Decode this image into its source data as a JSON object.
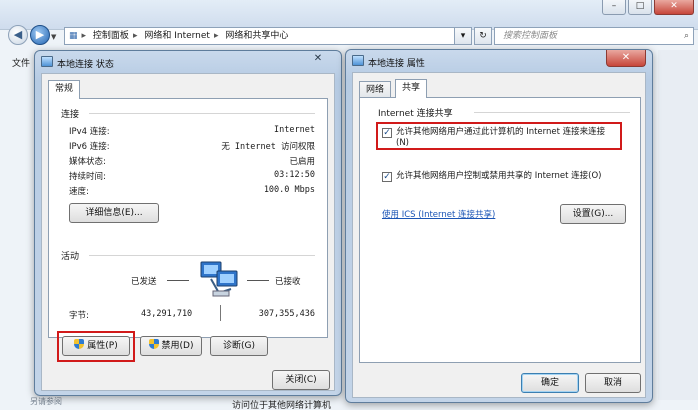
{
  "explorer": {
    "address": {
      "crumbs": [
        "控制面板",
        "网络和 Internet",
        "网络和共享中心"
      ],
      "refresh_glyph": "↻",
      "dropdown_glyph": "▾"
    },
    "search_placeholder": "搜索控制面板",
    "menu_fragment": "文件",
    "bottom_fragment": "访问位于其他网络计算机",
    "bottom_left_fragment": "另请参阅"
  },
  "status_dialog": {
    "title": "本地连接 状态",
    "close_glyph": "✕",
    "tab": "常规",
    "connection_label": "连接",
    "rows": [
      {
        "label": "IPv4 连接:",
        "value": "Internet"
      },
      {
        "label": "IPv6 连接:",
        "value": "无 Internet 访问权限"
      },
      {
        "label": "媒体状态:",
        "value": "已启用"
      },
      {
        "label": "持续时间:",
        "value": "03:12:50"
      },
      {
        "label": "速度:",
        "value": "100.0 Mbps"
      }
    ],
    "details_button": "详细信息(E)...",
    "activity_label": "活动",
    "sent_label": "已发送",
    "received_label": "已接收",
    "bytes_label": "字节:",
    "bytes_sent": "43,291,710",
    "bytes_received": "307,355,436",
    "properties_button": "属性(P)",
    "disable_button": "禁用(D)",
    "diagnose_button": "诊断(G)",
    "close_button": "关闭(C)"
  },
  "props_dialog": {
    "title": "本地连接 属性",
    "close_glyph": "✕",
    "tabs": [
      "网络",
      "共享"
    ],
    "group_title": "Internet 连接共享",
    "checkbox1": "允许其他网络用户通过此计算机的 Internet 连接来连接(N)",
    "checkbox2": "允许其他网络用户控制或禁用共享的 Internet 连接(O)",
    "check_glyph": "✓",
    "ics_link": "使用 ICS (Internet 连接共享)",
    "settings_button": "设置(G)...",
    "ok_button": "确定",
    "cancel_button": "取消"
  },
  "colors": {
    "highlight_box": "#d11a1a",
    "link": "#1b55b5"
  }
}
